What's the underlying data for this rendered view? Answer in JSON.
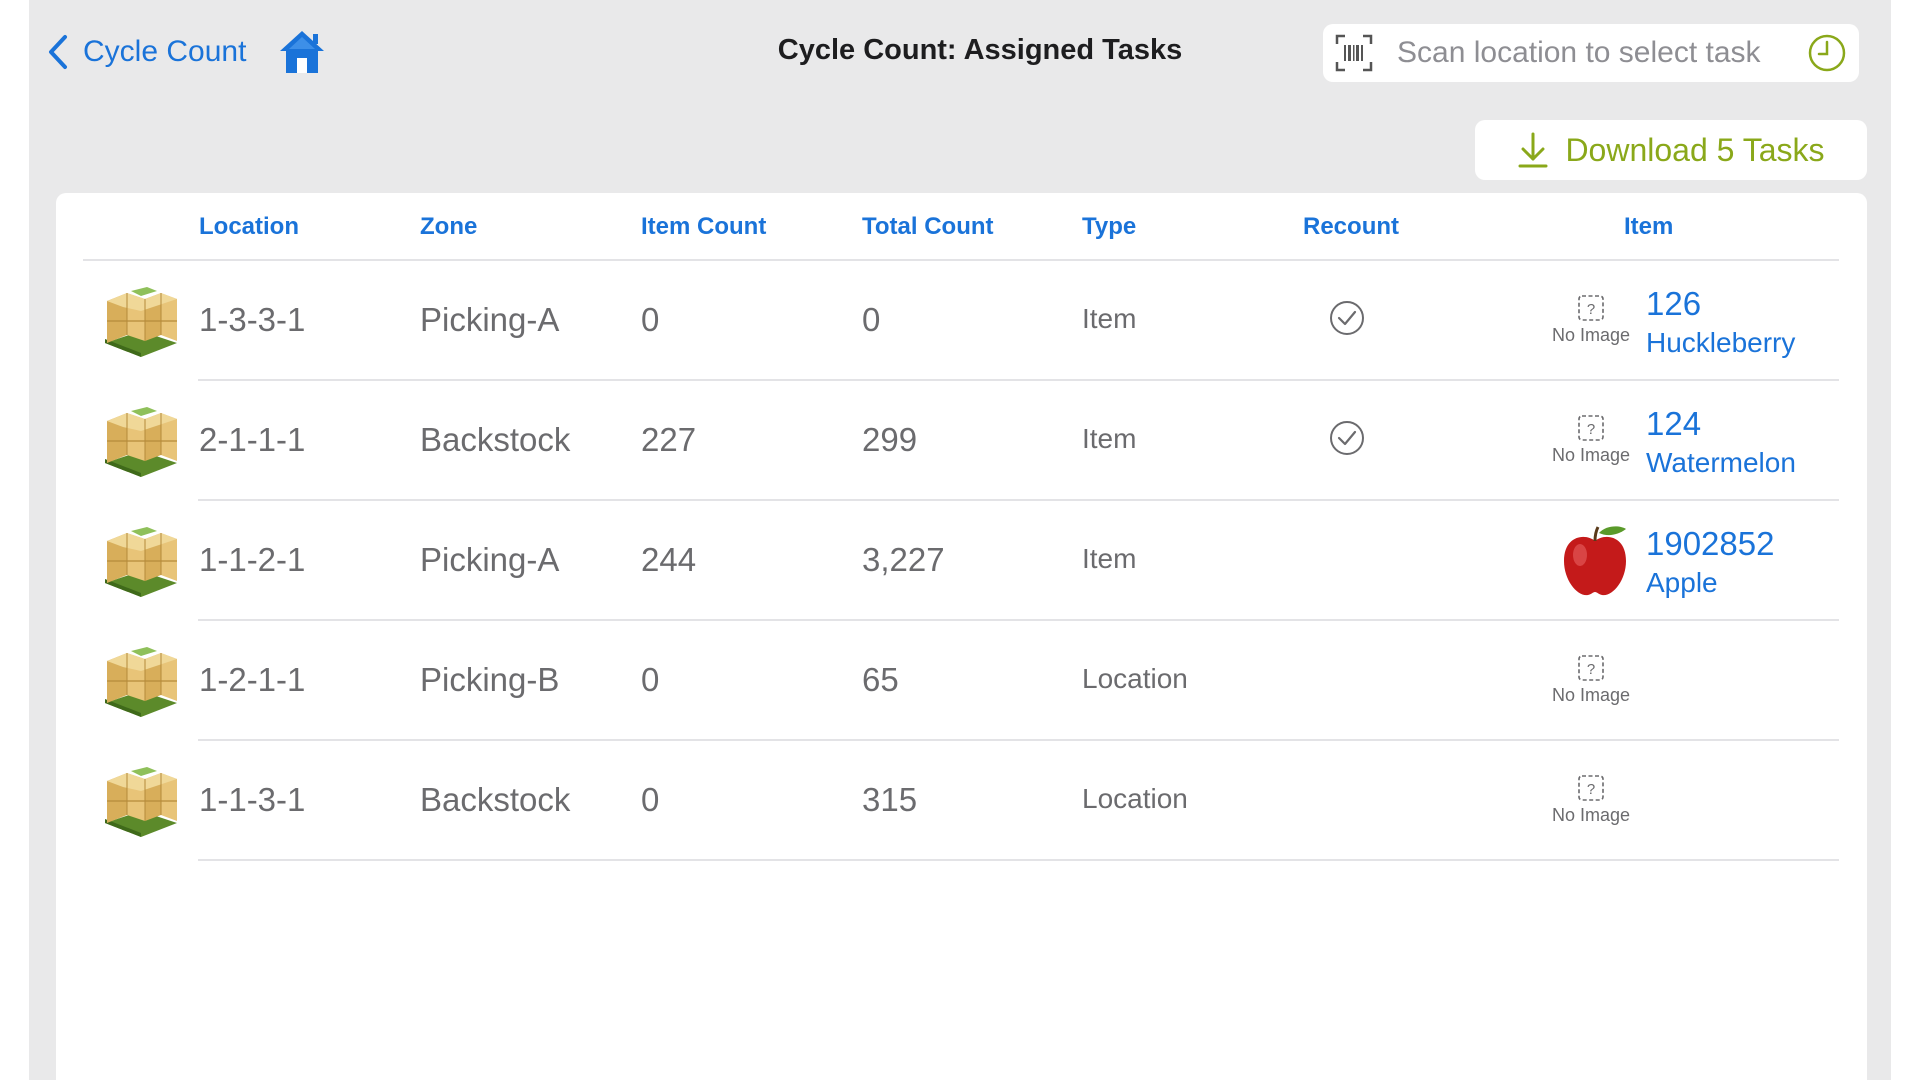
{
  "nav": {
    "back_label": "Cycle Count",
    "title": "Cycle Count: Assigned Tasks",
    "scan_placeholder": "Scan location to select task"
  },
  "actions": {
    "download_label": "Download 5 Tasks"
  },
  "colors": {
    "accent_blue": "#1a73d9",
    "download_green": "#8aa81a",
    "background": "#e9e9ea"
  },
  "table": {
    "headers": {
      "location": "Location",
      "zone": "Zone",
      "item_count": "Item Count",
      "total_count": "Total Count",
      "type": "Type",
      "recount": "Recount",
      "item": "Item"
    },
    "no_image_label": "No Image",
    "rows": [
      {
        "location": "1-3-3-1",
        "zone": "Picking-A",
        "item_count": "0",
        "total_count": "0",
        "type": "Item",
        "recount": true,
        "image": "no-image",
        "item_number": "126",
        "item_name": "Huckleberry"
      },
      {
        "location": "2-1-1-1",
        "zone": "Backstock",
        "item_count": "227",
        "total_count": "299",
        "type": "Item",
        "recount": true,
        "image": "no-image",
        "item_number": "124",
        "item_name": "Watermelon"
      },
      {
        "location": "1-1-2-1",
        "zone": "Picking-A",
        "item_count": "244",
        "total_count": "3,227",
        "type": "Item",
        "recount": false,
        "image": "apple",
        "item_number": "1902852",
        "item_name": "Apple"
      },
      {
        "location": "1-2-1-1",
        "zone": "Picking-B",
        "item_count": "0",
        "total_count": "65",
        "type": "Location",
        "recount": false,
        "image": "no-image",
        "item_number": "",
        "item_name": ""
      },
      {
        "location": "1-1-3-1",
        "zone": "Backstock",
        "item_count": "0",
        "total_count": "315",
        "type": "Location",
        "recount": false,
        "image": "no-image",
        "item_number": "",
        "item_name": ""
      }
    ]
  }
}
